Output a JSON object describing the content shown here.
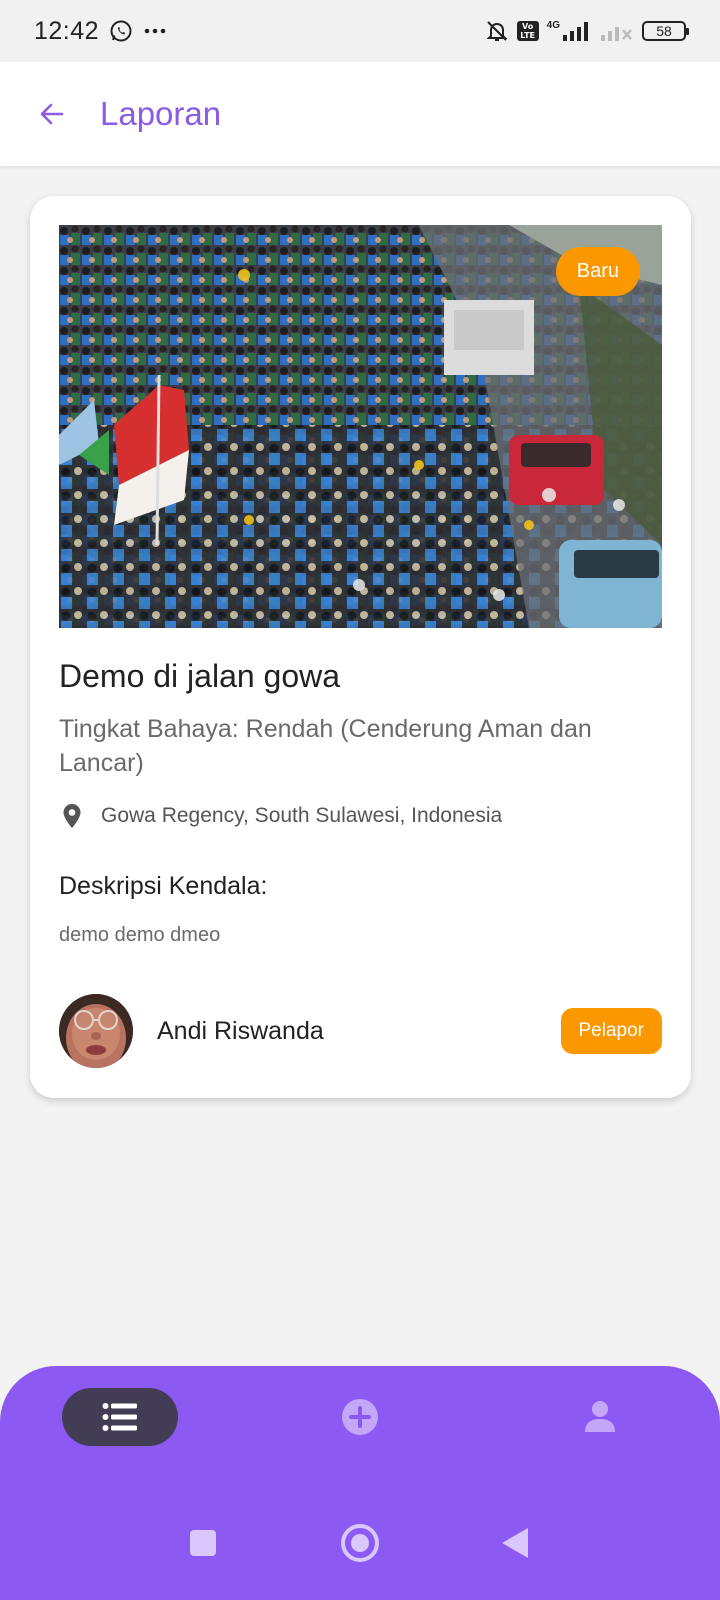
{
  "status_bar": {
    "time": "12:42",
    "volte": "Vo LTE",
    "network": "4G",
    "battery": "58"
  },
  "app_bar": {
    "title": "Laporan"
  },
  "report": {
    "badge": "Baru",
    "title": "Demo di jalan gowa",
    "danger_level": "Tingkat Bahaya: Rendah (Cenderung Aman dan Lancar)",
    "location": "Gowa Regency, South Sulawesi, Indonesia",
    "description_heading": "Deskripsi Kendala:",
    "description": "demo demo dmeo",
    "reporter_name": "Andi Riswanda",
    "reporter_role": "Pelapor"
  },
  "colors": {
    "accent": "#8a5ce6",
    "nav_background": "#8d59f3",
    "badge": "#fb9800",
    "nav_active_pill": "#433c55"
  },
  "bottom_nav": {
    "items": [
      {
        "icon": "list-icon",
        "active": true
      },
      {
        "icon": "add-circle-icon",
        "active": false
      },
      {
        "icon": "person-icon",
        "active": false
      }
    ]
  }
}
